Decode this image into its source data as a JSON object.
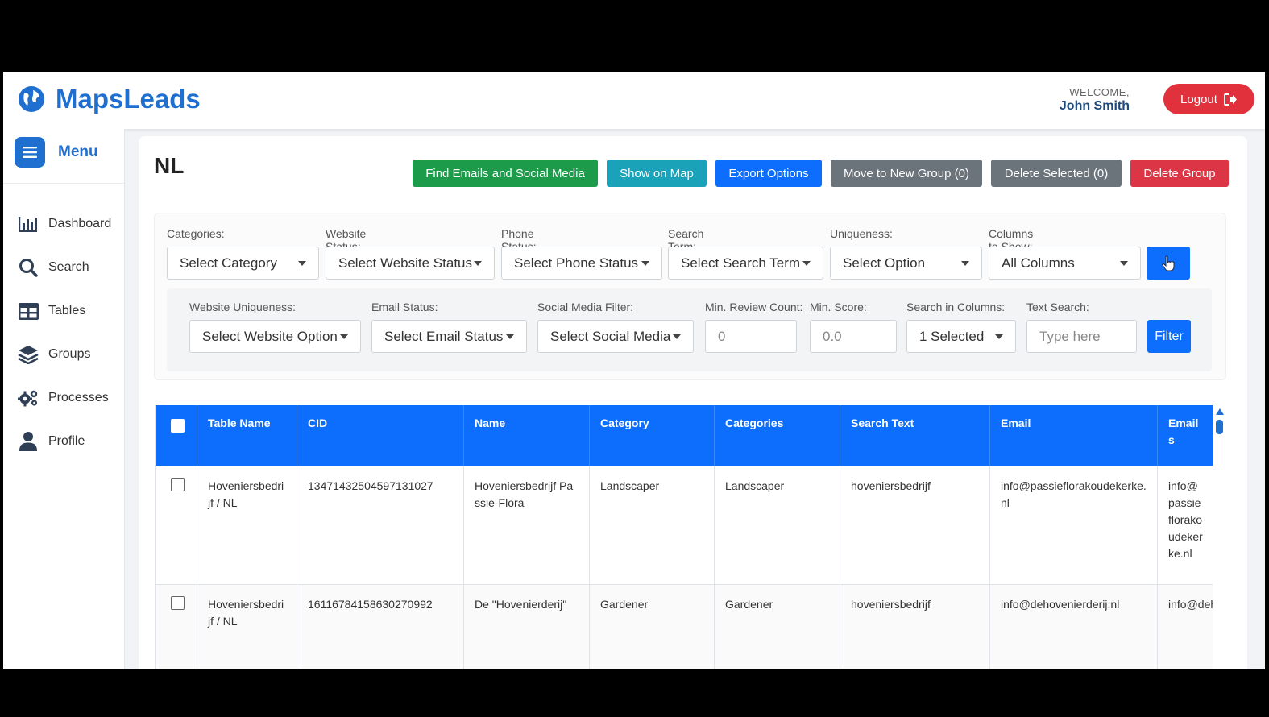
{
  "header": {
    "brand": "MapsLeads",
    "welcome_label": "WELCOME,",
    "user_name": "John Smith",
    "logout_label": "Logout"
  },
  "sidebar": {
    "menu_label": "Menu",
    "items": [
      {
        "label": "Dashboard",
        "icon": "bar-chart-icon"
      },
      {
        "label": "Search",
        "icon": "search-icon"
      },
      {
        "label": "Tables",
        "icon": "table-icon"
      },
      {
        "label": "Groups",
        "icon": "layers-icon"
      },
      {
        "label": "Processes",
        "icon": "gears-icon"
      },
      {
        "label": "Profile",
        "icon": "user-icon"
      }
    ]
  },
  "page": {
    "title": "NL"
  },
  "actions": {
    "find_emails": "Find Emails and Social Media",
    "show_on_map": "Show on Map",
    "export_options": "Export Options",
    "move_to_group": "Move to New Group (0)",
    "delete_selected": "Delete Selected (0)",
    "delete_group": "Delete Group"
  },
  "filters": {
    "categories": {
      "label": "Categories:",
      "value": "Select Category"
    },
    "website_status": {
      "label": "Website Status:",
      "value": "Select Website Status"
    },
    "phone_status": {
      "label": "Phone Status:",
      "value": "Select Phone Status"
    },
    "search_term": {
      "label": "Search Term:",
      "value": "Select Search Term"
    },
    "uniqueness": {
      "label": "Uniqueness:",
      "value": "Select Option"
    },
    "columns_to_show": {
      "label": "Columns to Show:",
      "value": "All Columns"
    },
    "website_uniqueness": {
      "label": "Website Uniqueness:",
      "value": "Select Website Option"
    },
    "email_status": {
      "label": "Email Status:",
      "value": "Select Email Status"
    },
    "social_media": {
      "label": "Social Media Filter:",
      "value": "Select Social Media"
    },
    "min_review_count": {
      "label": "Min. Review Count:",
      "placeholder": "0"
    },
    "min_score": {
      "label": "Min. Score:",
      "placeholder": "0.0"
    },
    "search_in_columns": {
      "label": "Search in Columns:",
      "value": "1 Selected"
    },
    "text_search": {
      "label": "Text Search:",
      "placeholder": "Type here"
    },
    "filter_button": "Filter"
  },
  "table": {
    "columns": [
      "Table Name",
      "CID",
      "Name",
      "Category",
      "Categories",
      "Search Text",
      "Email",
      "Emails"
    ],
    "rows": [
      {
        "table_name": "Hoveniersbedrijf / NL",
        "cid": "13471432504597131027",
        "name": "Hoveniersbedrijf Passie-Flora",
        "category": "Landscaper",
        "categories": "Landscaper",
        "search_text": "hoveniersbedrijf",
        "email": "info@passieflorakoudekerke.nl",
        "emails": "info@passieflorakoudekerke.nl"
      },
      {
        "table_name": "Hoveniersbedrijf / NL",
        "cid": "16116784158630270992",
        "name": "De \"Hovenierderij\"",
        "category": "Gardener",
        "categories": "Gardener",
        "search_text": "hoveniersbedrijf",
        "email": "info@dehovenierderij.nl",
        "emails": "info@dehovenierderij.nl"
      }
    ]
  },
  "colors": {
    "brand_blue": "#1e6fd0",
    "primary": "#0d6efd",
    "success": "#1c9c4a",
    "info": "#1aa2b8",
    "secondary": "#6b737b",
    "danger": "#dc3545"
  }
}
